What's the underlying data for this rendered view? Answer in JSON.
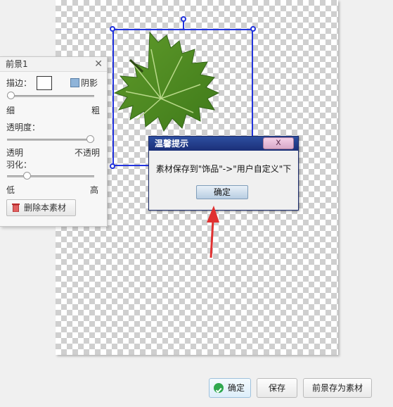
{
  "panel": {
    "title": "前景1",
    "stroke_label": "描边：",
    "shadow_label": "阴影",
    "thin_label": "细",
    "thick_label": "粗",
    "opacity_label": "透明度：",
    "transparent_label": "透明",
    "opaque_label": "不透明",
    "feather_label": "羽化：",
    "low_label": "低",
    "high_label": "高",
    "delete_button": "删除本素材",
    "stroke_level": 0.0,
    "opacity_level": 1.0,
    "feather_level": 0.2
  },
  "dialog": {
    "title": "温馨提示",
    "close_label": "x",
    "message": "素材保存到\"饰品\"->\"用户自定义\"下",
    "ok_label": "确定"
  },
  "footer": {
    "confirm_label": "确定",
    "save_label": "保存",
    "save_as_label": "前景存为素材"
  },
  "colors": {
    "selection": "#2233dd",
    "dialog_title": "#1b2f78",
    "arrow": "#e03030"
  }
}
